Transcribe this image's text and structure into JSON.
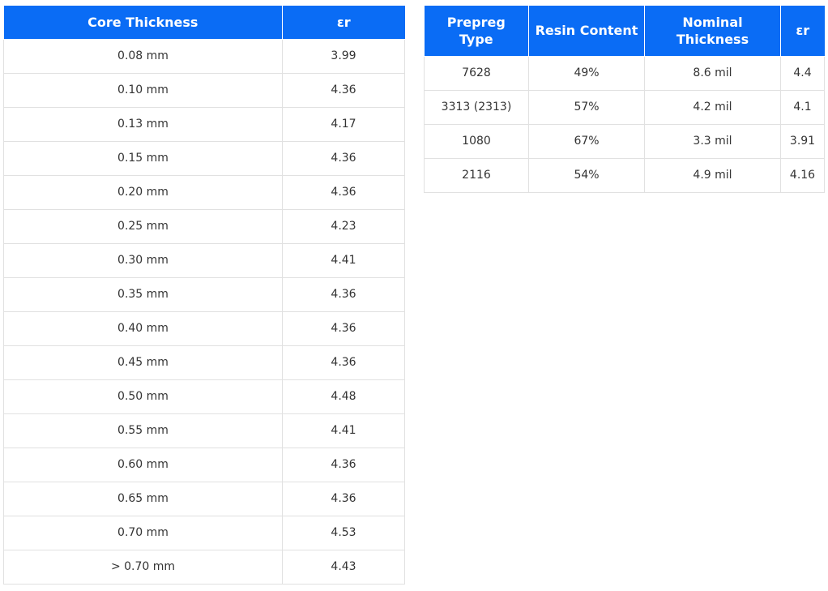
{
  "core_table": {
    "headers": {
      "thickness": "Core Thickness",
      "er": "εr"
    },
    "rows": [
      {
        "thickness": "0.08 mm",
        "er": "3.99"
      },
      {
        "thickness": "0.10 mm",
        "er": "4.36"
      },
      {
        "thickness": "0.13 mm",
        "er": "4.17"
      },
      {
        "thickness": "0.15 mm",
        "er": "4.36"
      },
      {
        "thickness": "0.20 mm",
        "er": "4.36"
      },
      {
        "thickness": "0.25 mm",
        "er": "4.23"
      },
      {
        "thickness": "0.30 mm",
        "er": "4.41"
      },
      {
        "thickness": "0.35 mm",
        "er": "4.36"
      },
      {
        "thickness": "0.40 mm",
        "er": "4.36"
      },
      {
        "thickness": "0.45 mm",
        "er": "4.36"
      },
      {
        "thickness": "0.50 mm",
        "er": "4.48"
      },
      {
        "thickness": "0.55 mm",
        "er": "4.41"
      },
      {
        "thickness": "0.60 mm",
        "er": "4.36"
      },
      {
        "thickness": "0.65 mm",
        "er": "4.36"
      },
      {
        "thickness": "0.70 mm",
        "er": "4.53"
      },
      {
        "thickness": "> 0.70 mm",
        "er": "4.43"
      }
    ]
  },
  "prepreg_table": {
    "headers": {
      "type": "Prepreg Type",
      "resin": "Resin Content",
      "thickness": "Nominal Thickness",
      "er": "εr"
    },
    "rows": [
      {
        "type": "7628",
        "resin": "49%",
        "thickness": "8.6 mil",
        "er": "4.4"
      },
      {
        "type": "3313 (2313)",
        "resin": "57%",
        "thickness": "4.2 mil",
        "er": "4.1"
      },
      {
        "type": "1080",
        "resin": "67%",
        "thickness": "3.3 mil",
        "er": "3.91"
      },
      {
        "type": "2116",
        "resin": "54%",
        "thickness": "4.9 mil",
        "er": "4.16"
      }
    ]
  },
  "colors": {
    "header_bg": "#0a6cf5",
    "header_text": "#ffffff",
    "border": "#e1e1e1",
    "cell_text": "#333333"
  }
}
